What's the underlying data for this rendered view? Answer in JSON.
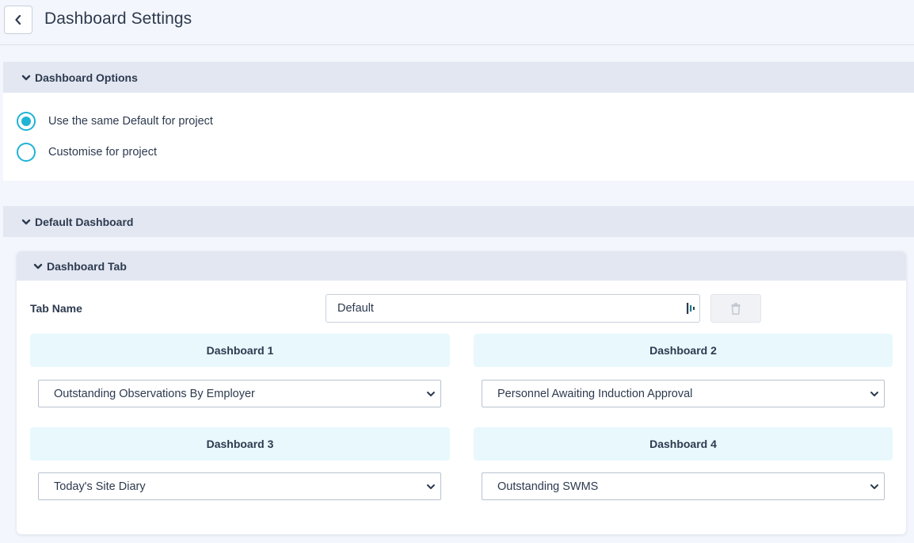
{
  "header": {
    "title": "Dashboard Settings",
    "back_icon": "chevron-left-icon"
  },
  "dashboard_options": {
    "title": "Dashboard Options",
    "options": [
      {
        "label": "Use the same Default for project",
        "checked": true
      },
      {
        "label": "Customise for project",
        "checked": false
      }
    ]
  },
  "default_dashboard": {
    "title": "Default Dashboard",
    "tab": {
      "title": "Dashboard Tab",
      "tab_name_label": "Tab Name",
      "tab_name_value": "Default",
      "delete_icon": "trash-icon",
      "dashboards": [
        {
          "heading": "Dashboard 1",
          "selected": "Outstanding Observations By Employer"
        },
        {
          "heading": "Dashboard 2",
          "selected": "Personnel Awaiting Induction Approval"
        },
        {
          "heading": "Dashboard 3",
          "selected": "Today's Site Diary"
        },
        {
          "heading": "Dashboard 4",
          "selected": "Outstanding SWMS"
        }
      ]
    }
  },
  "colors": {
    "accent": "#1fb3d5",
    "section_header_bg": "#e2e7f1",
    "dashboard_head_bg": "#e8f8fc",
    "page_bg": "#f3f6fc"
  }
}
